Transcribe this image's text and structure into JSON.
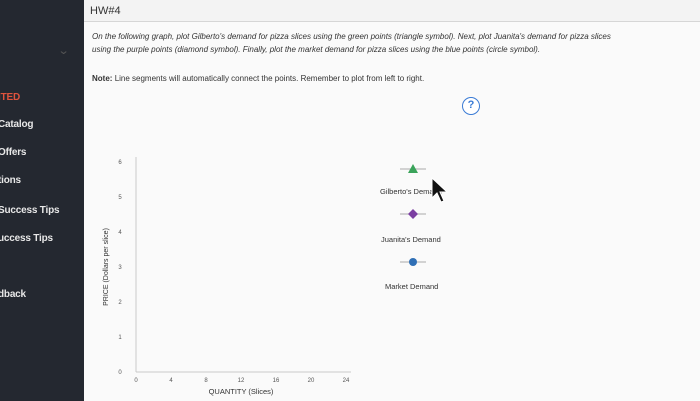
{
  "header": {
    "title": "HW#4"
  },
  "sidebar": {
    "items": [
      {
        "label": "ITED",
        "active": true
      },
      {
        "label": "Catalog"
      },
      {
        "label": "Offers"
      },
      {
        "label": "tions"
      },
      {
        "label": "Success Tips"
      },
      {
        "label": "uccess Tips"
      },
      {
        "label": "dback"
      }
    ]
  },
  "instructions": {
    "line1": "On the following graph, plot Gilberto's demand for pizza slices using the green points (triangle symbol). Next, plot Juanita's demand for pizza slices",
    "line2": "using the purple points (diamond symbol). Finally, plot the market demand for pizza slices using the blue points (circle symbol).",
    "note_label": "Note:",
    "note_text": "Line segments will automatically connect the points. Remember to plot from left to right."
  },
  "help": {
    "icon": "question-icon",
    "label": "?"
  },
  "chart_data": {
    "type": "scatter",
    "xlabel": "QUANTITY (Slices)",
    "ylabel": "PRICE (Dollars per slice)",
    "xlim": [
      0,
      24
    ],
    "ylim": [
      0,
      6
    ],
    "x_ticks": [
      0,
      4,
      8,
      12,
      16,
      20,
      24
    ],
    "y_ticks": [
      0,
      1,
      2,
      3,
      4,
      5,
      6
    ],
    "series": [],
    "legend": [
      {
        "name": "Gilberto's Demand",
        "symbol": "triangle",
        "color": "#3aa35a",
        "line": "#aaa"
      },
      {
        "name": "Juanita's Demand",
        "symbol": "diamond",
        "color": "#7b3fa1",
        "line": "#aaa"
      },
      {
        "name": "Market Demand",
        "symbol": "circle",
        "color": "#2f6fb5",
        "line": "#aaa"
      }
    ]
  },
  "colors": {
    "sidebar_bg": "#242830",
    "accent": "#e0533d",
    "help": "#3a7bd5"
  }
}
